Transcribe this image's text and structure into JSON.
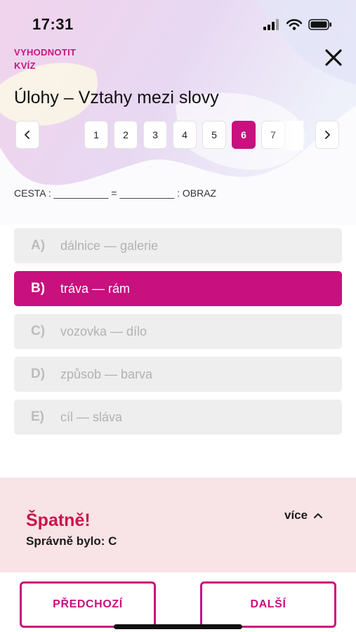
{
  "status_bar": {
    "time": "17:31"
  },
  "header": {
    "evaluate_label": "VYHODNOTIT KVÍZ",
    "title": "Úlohy – Vztahy mezi slovy"
  },
  "pagination": {
    "pages": [
      "1",
      "2",
      "3",
      "4",
      "5",
      "6",
      "7"
    ],
    "active": "6"
  },
  "question": "CESTA : __________ = __________ : OBRAZ",
  "answers": [
    {
      "letter": "A)",
      "text": "dálnice — galerie",
      "selected": false
    },
    {
      "letter": "B)",
      "text": "tráva — rám",
      "selected": true
    },
    {
      "letter": "C)",
      "text": "vozovka — dílo",
      "selected": false
    },
    {
      "letter": "D)",
      "text": "způsob — barva",
      "selected": false
    },
    {
      "letter": "E)",
      "text": "cíl — sláva",
      "selected": false
    }
  ],
  "feedback": {
    "title": "Špatně!",
    "correct_text": "Správně bylo:  C",
    "more_label": "více"
  },
  "buttons": {
    "previous": "PŘEDCHOZÍ",
    "next": "DALŠÍ"
  },
  "colors": {
    "accent": "#c8107e",
    "error": "#c8154a",
    "feedback_bg": "#f8e3e7",
    "answer_bg": "#eeeeee"
  },
  "icons": [
    "signal-icon",
    "wifi-icon",
    "battery-icon",
    "close-icon",
    "chevron-left-icon",
    "chevron-right-icon",
    "chevron-up-icon"
  ]
}
